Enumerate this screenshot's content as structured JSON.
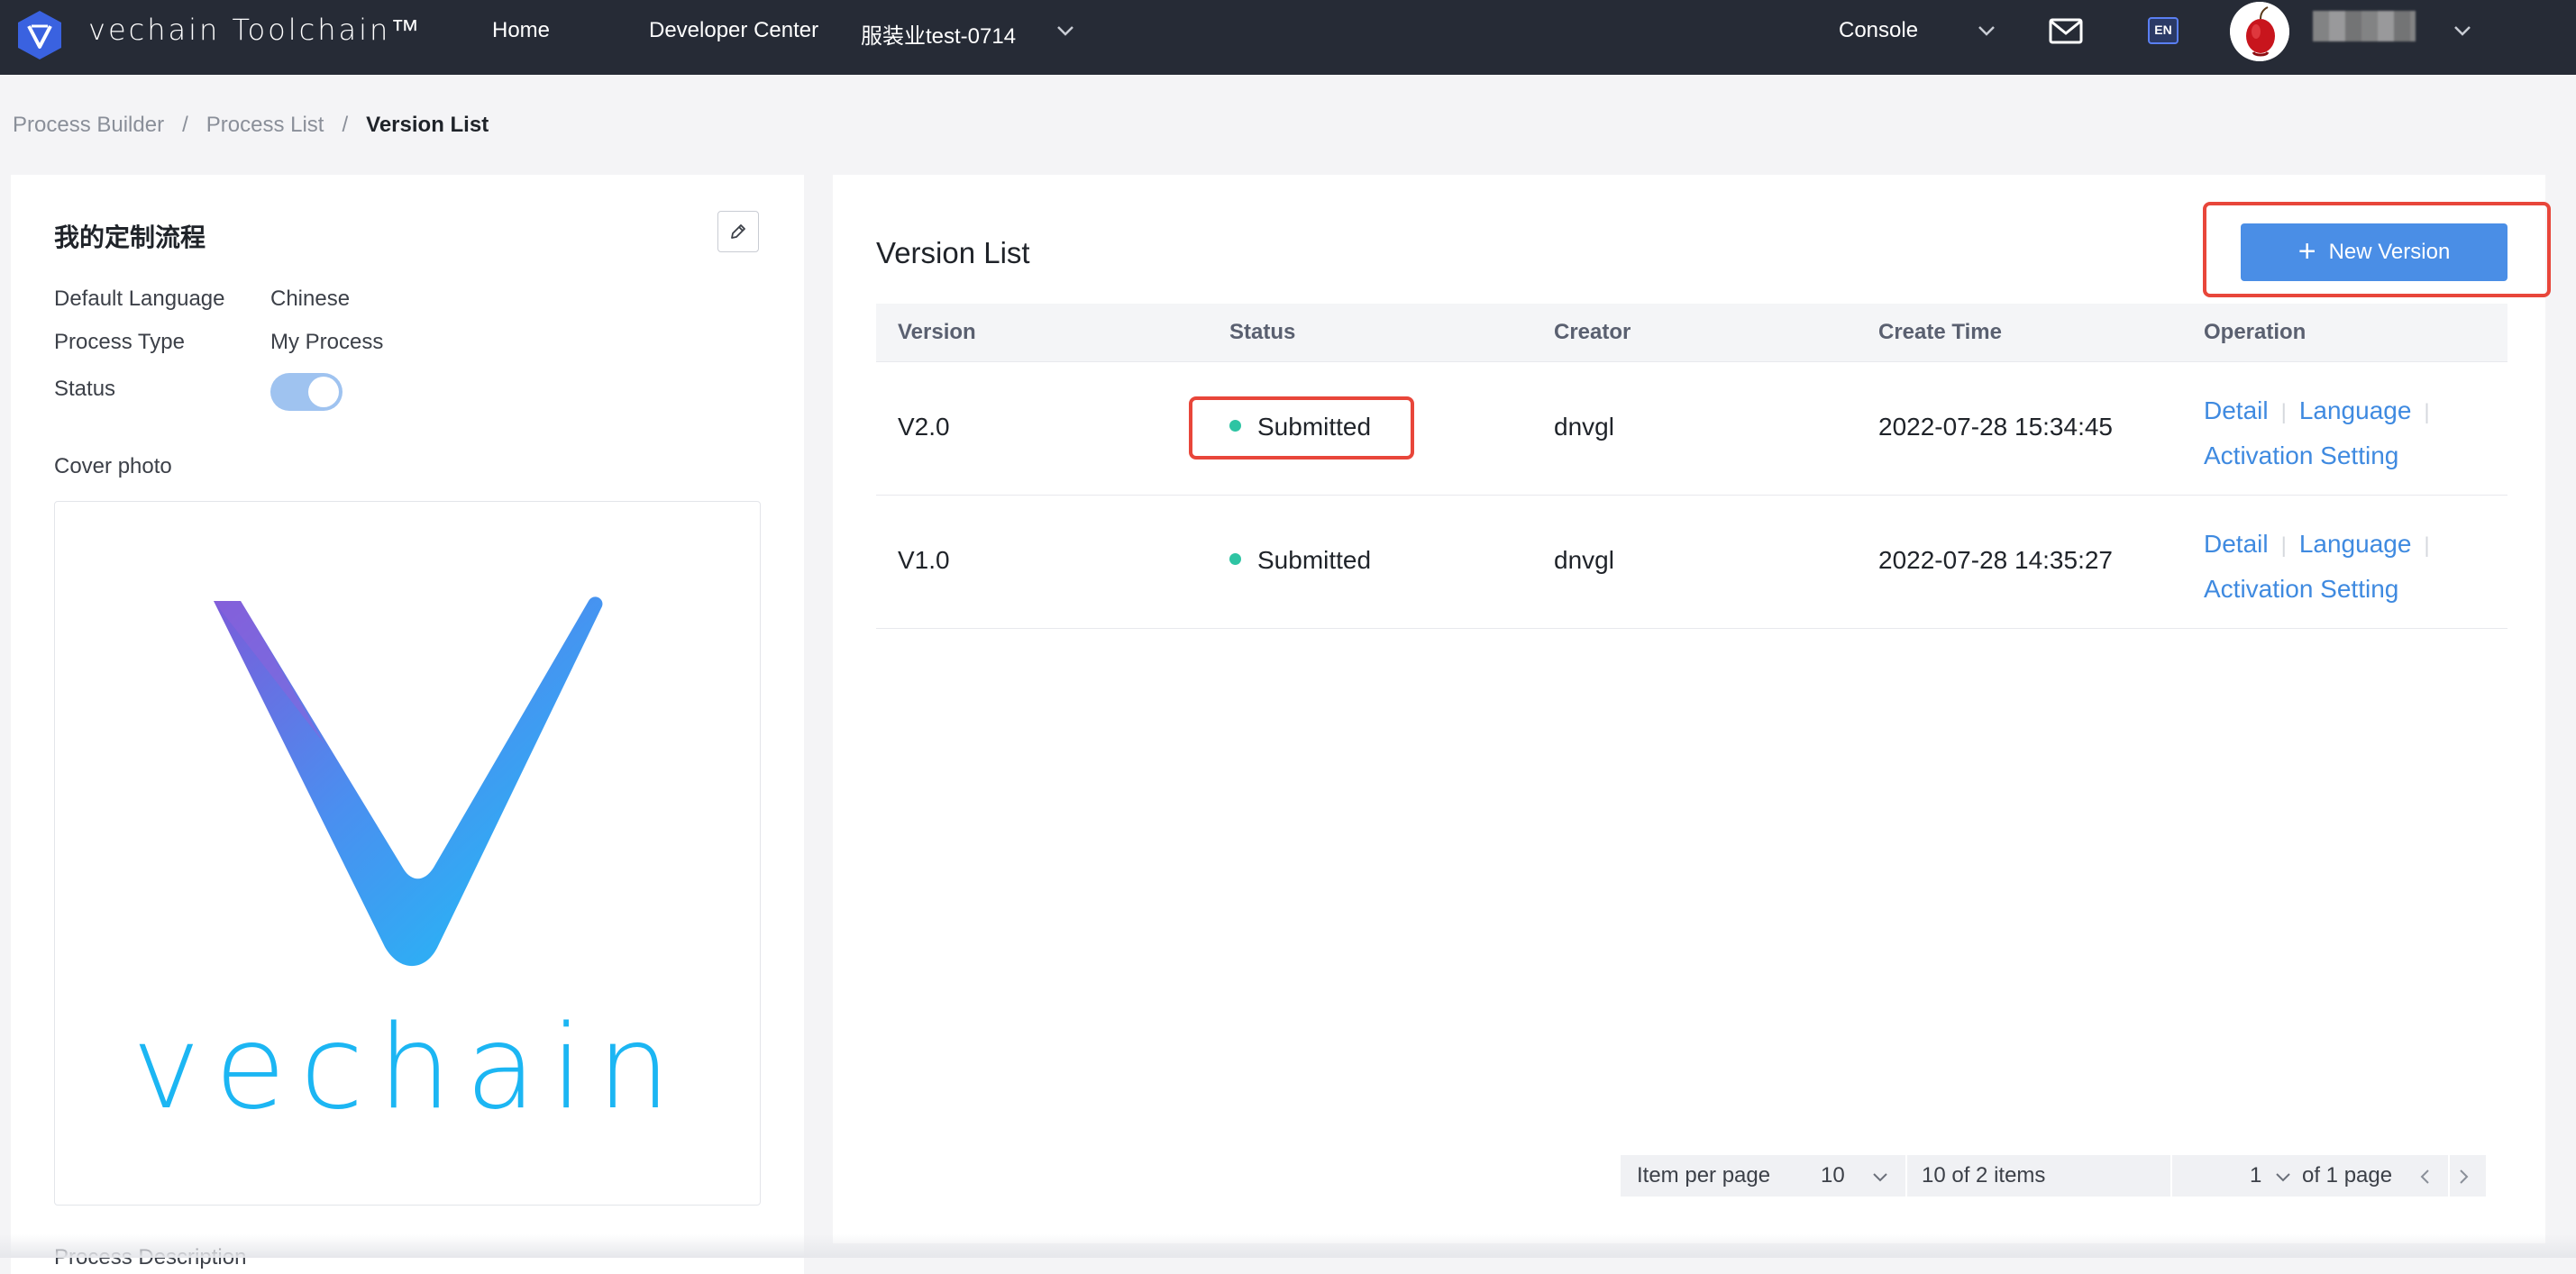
{
  "header": {
    "logo_text": "vechain Toolchain™",
    "nav": {
      "home": "Home",
      "developer_center": "Developer Center",
      "org": "服装业test-0714",
      "console": "Console"
    },
    "language_badge": "EN"
  },
  "breadcrumb": {
    "items": [
      "Process Builder",
      "Process List",
      "Version List"
    ],
    "separator": "/"
  },
  "process": {
    "title": "我的定制流程",
    "fields": [
      {
        "label": "Default Language",
        "value": "Chinese"
      },
      {
        "label": "Process Type",
        "value": "My Process"
      },
      {
        "label": "Status",
        "value": ""
      }
    ],
    "status_on": true,
    "cover_label": "Cover photo",
    "cover_logo_text": "vechain",
    "description_label": "Process Description"
  },
  "version_list": {
    "title": "Version List",
    "new_button": "New Version",
    "columns": {
      "version": "Version",
      "status": "Status",
      "creator": "Creator",
      "create_time": "Create Time",
      "operation": "Operation"
    },
    "rows": [
      {
        "version": "V2.0",
        "status": "Submitted",
        "creator": "dnvgl",
        "create_time": "2022-07-28 15:34:45",
        "ops": {
          "detail": "Detail",
          "language": "Language",
          "activation": "Activation Setting"
        }
      },
      {
        "version": "V1.0",
        "status": "Submitted",
        "creator": "dnvgl",
        "create_time": "2022-07-28 14:35:27",
        "ops": {
          "detail": "Detail",
          "language": "Language",
          "activation": "Activation Setting"
        }
      }
    ],
    "status_color": "#2ec4a3",
    "link_color": "#3f8ae0"
  },
  "pagination": {
    "per_page_label": "Item per page",
    "per_page_value": "10",
    "items_summary": "10 of 2 items",
    "current_page": "1",
    "page_summary": "of 1 page"
  },
  "colors": {
    "topbar": "#262b36",
    "primary": "#4a8ee6",
    "highlight": "#e8463a"
  }
}
